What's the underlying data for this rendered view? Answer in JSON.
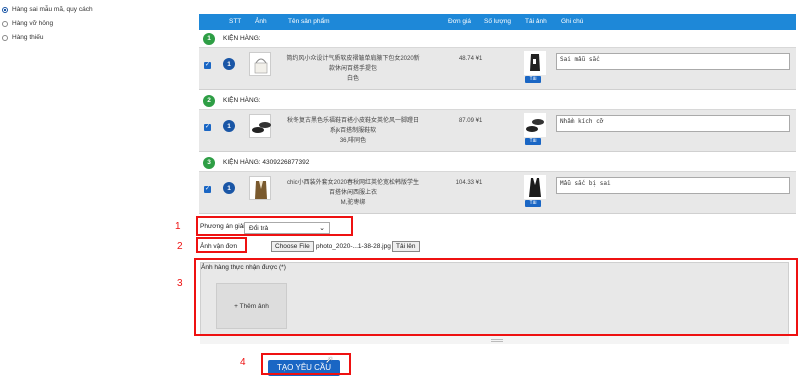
{
  "sidebar": {
    "options": [
      {
        "label": "Hàng sai mẫu mã, quy cách",
        "selected": true
      },
      {
        "label": "Hàng vỡ hỏng",
        "selected": false
      },
      {
        "label": "Hàng thiếu",
        "selected": false
      }
    ]
  },
  "table": {
    "headers": [
      "STT",
      "Ảnh",
      "Tên sản phẩm",
      "Đơn giá",
      "Số lượng",
      "Tải ảnh",
      "Ghi chú"
    ]
  },
  "shops": [
    {
      "index": "1",
      "label": "KIỆN HÀNG:",
      "item": {
        "stt": "1",
        "name_line1": "简约风小众设计气质软皮褶皱单肩腋下包女2020新",
        "name_line2": "款休闲百搭手提包",
        "variant": "白色",
        "price": "48.74 ¥",
        "quantity": "1",
        "upload_label": "Tải",
        "note": "Sai mẫu sắc"
      }
    },
    {
      "index": "2",
      "label": "KIỆN HÀNG:",
      "item": {
        "stt": "1",
        "name_line1": "秋冬复古黑色乐福鞋百褡小皮鞋女英伦风一脚蹬日",
        "name_line2": "系jk百搭制服鞋软",
        "variant": "36,啡同色",
        "price": "87.09 ¥",
        "quantity": "1",
        "upload_label": "Tải",
        "note": "Nhầm kích cỡ"
      }
    },
    {
      "index": "3",
      "label": "KIỆN HÀNG: 4309226877392",
      "item": {
        "stt": "1",
        "name_line1": "chic小西装外套女2020春秋网红英伦宽松韩版学生",
        "name_line2": "百搭休闲西服上衣",
        "variant": "M,驼枣绑",
        "price": "104.33 ¥",
        "quantity": "1",
        "upload_label": "Tải",
        "note": "Mẫu sắc bị sai"
      }
    }
  ],
  "form": {
    "resolution_label": "Phương án giải quyết *",
    "resolution_value": "Đổi trả",
    "waybill_label": "Ảnh vận đơn",
    "choose_file_label": "Choose File",
    "file_name": "photo_2020-...1-38-28.jpg",
    "upload_button": "Tải lên",
    "received_photos_label": "Ảnh hàng thực nhận được (*)",
    "add_photo_label": "+ Thêm ảnh",
    "submit_label": "TẠO YÊU CẦU"
  },
  "annotations": [
    "1",
    "2",
    "3",
    "4"
  ],
  "colors": {
    "header_blue": "#1e88d8",
    "button_blue": "#1a66c4",
    "shop_green": "#2e9e45",
    "highlight_red": "#e11111"
  }
}
